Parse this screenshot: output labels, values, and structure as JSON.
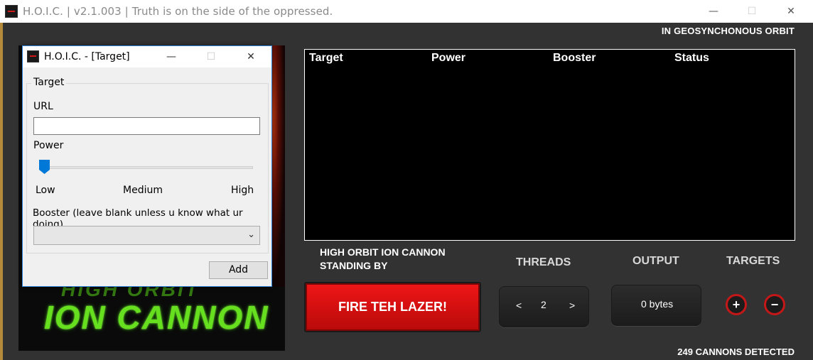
{
  "window": {
    "title": "H.O.I.C. | v2.1.003 | Truth is on the side of the oppressed.",
    "minimize": "—",
    "maximize": "☐",
    "close": "✕"
  },
  "header": {
    "orbit_status": "IN GEOSYNCHONOUS ORBIT"
  },
  "logo": {
    "line1": "HIGH ORBIT",
    "line2": "ION CANNON"
  },
  "table": {
    "columns": [
      "Target",
      "Power",
      "Booster",
      "Status"
    ],
    "rows": []
  },
  "status": {
    "line1": "HIGH ORBIT ION CANNON",
    "line2": "STANDING BY"
  },
  "fire_button": "FIRE TEH LAZER!",
  "threads": {
    "label": "THREADS",
    "decrement": "<",
    "value": "2",
    "increment": ">"
  },
  "output": {
    "label": "OUTPUT",
    "value": "0 bytes"
  },
  "targets": {
    "label": "TARGETS",
    "add": "+",
    "remove": "−"
  },
  "footer": {
    "cannons": "249 CANNONS DETECTED"
  },
  "dialog": {
    "title": "H.O.I.C. - [Target]",
    "minimize": "—",
    "maximize": "☐",
    "close": "✕",
    "group_label": "Target",
    "url_label": "URL",
    "url_value": "",
    "power_label": "Power",
    "power_level": 0,
    "power_low": "Low",
    "power_medium": "Medium",
    "power_high": "High",
    "booster_label": "Booster (leave blank unless u know what ur doing)",
    "booster_value": "",
    "add_button": "Add"
  },
  "colors": {
    "background": "#323232",
    "accent_red": "#e01414",
    "logo_green": "#66e01e",
    "dialog_bg": "#f0f0f0",
    "slider_blue": "#0078d7"
  }
}
